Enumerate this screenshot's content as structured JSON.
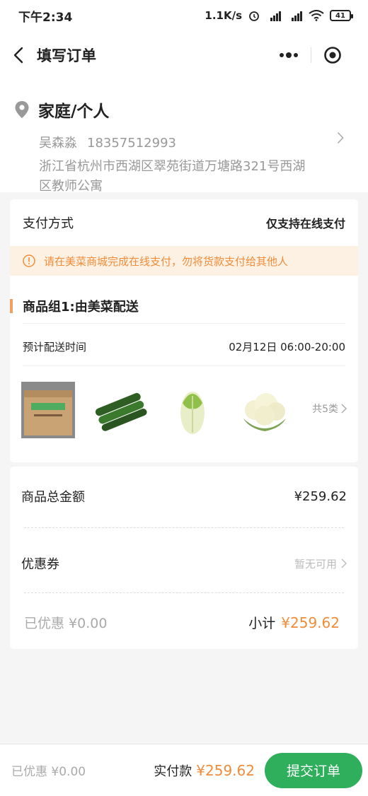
{
  "status_bar": {
    "time": "下午2:34",
    "network_speed": "1.1K/s",
    "battery": "41",
    "icons": [
      "alarm-icon",
      "hd-signal-icon",
      "hd-signal-icon",
      "wifi-icon",
      "battery-icon"
    ]
  },
  "nav": {
    "title": "填写订单",
    "back_icon": "back-arrow-icon",
    "more_icon": "more-dots-icon",
    "close_icon": "target-close-icon"
  },
  "address": {
    "type": "家庭/个人",
    "name": "吴森淼",
    "phone": "18357512993",
    "detail": "浙江省杭州市西湖区翠苑街道万塘路321号西湖区教师公寓"
  },
  "payment": {
    "label": "支付方式",
    "value": "仅支持在线支付",
    "notice": "请在美菜商城完成在线支付，勿将货款支付给其他人"
  },
  "group": {
    "title": "商品组1:由美菜配送",
    "delivery_label": "预计配送时间",
    "delivery_time": "02月12日 06:00-20:00",
    "items": [
      "box-product",
      "cucumber",
      "napa-cabbage",
      "cauliflower"
    ],
    "count_label": "共5类"
  },
  "summary": {
    "total_label": "商品总金额",
    "total_value": "¥259.62",
    "coupon_label": "优惠券",
    "coupon_value": "暂无可用",
    "discount_text": "已优惠 ¥0.00",
    "subtotal_label": "小计",
    "subtotal_value": "¥259.62"
  },
  "bottom": {
    "discount_text": "已优惠 ¥0.00",
    "pay_label": "实付款",
    "pay_value": "¥259.62",
    "submit_label": "提交订单"
  },
  "colors": {
    "accent_orange": "#f08c3a",
    "submit_green": "#2fae5b",
    "notice_bg": "#fdf1e3"
  }
}
